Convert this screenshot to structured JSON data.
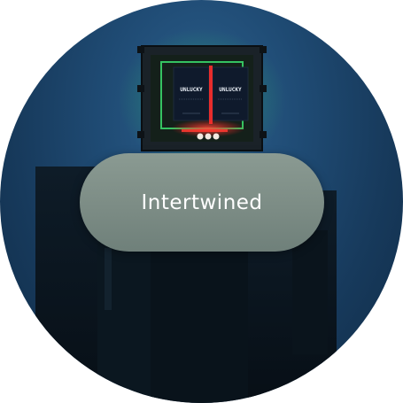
{
  "card": {
    "title": "Intertwined"
  },
  "device": {
    "left_screen_label": "UNLUCKY",
    "right_screen_label": "UNLUCKY"
  },
  "colors": {
    "sky": "#1f4b74",
    "sky_dark": "#0f2a45",
    "pill": "#7c8c85",
    "glow_green": "#35d86a",
    "glow_red": "#ff3030",
    "silhouette": "#0a141d"
  }
}
